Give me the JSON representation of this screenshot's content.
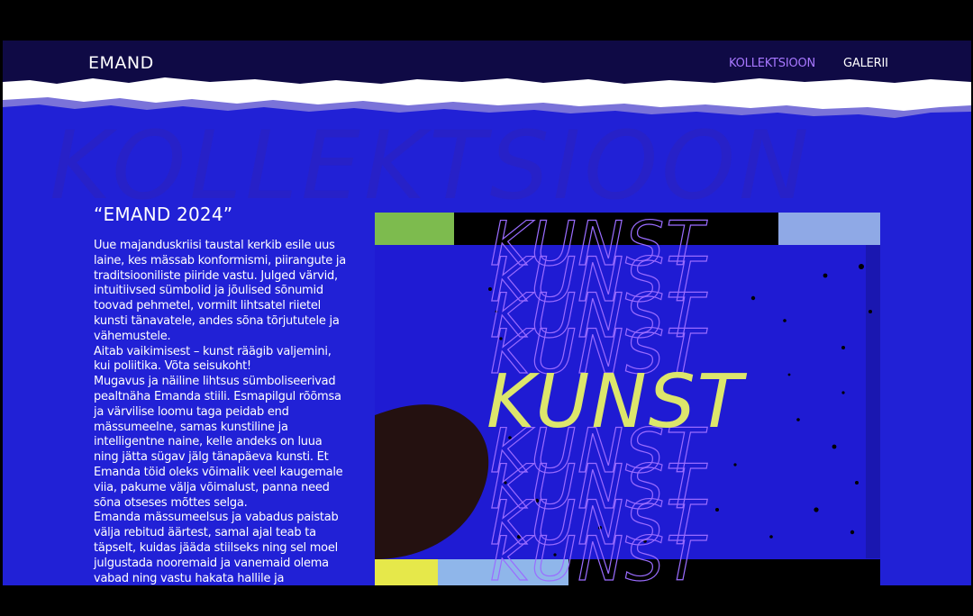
{
  "header": {
    "logo": "EMAND",
    "nav": [
      {
        "label": "KOLLEKTSIOON",
        "active": true
      },
      {
        "label": "GALERII",
        "active": false
      }
    ]
  },
  "section": {
    "background_word": "KOLLEKTSIOON",
    "title": "“EMAND 2024”",
    "paragraphs": [
      "Uue majanduskriisi taustal kerkib esile uus laine, kes mässab konformismi, piirangute ja traditsiooniliste piiride vastu. Julged värvid, intuitiivsed sümbolid ja jõulised sõnumid toovad pehmetel, vormilt lihtsatel riietel kunsti tänavatele, andes sõna tõrjututele ja vähemustele.",
      "Aitab vaikimisest – kunst räägib valjemini, kui poliitika. Võta seisukoht!",
      "Mugavus ja näiline lihtsus sümboliseerivad pealtnäha Emanda stiili. Esmapilgul rõõmsa ja värvilise loomu taga peidab end mässumeelne, samas kunstiline ja intelligentne naine, kelle andeks on luua ning jätta sügav jälg tänapäeva kunsti. Et Emanda töid oleks võimalik veel kaugemale viia, pakume välja võimalust, panna need sõna otseses mõttes selga.",
      "Emanda mässumeelsus ja vabadus paistab välja rebitud äärtest, samal ajal teab ta täpselt, kuidas jääda stiilseks ning sel moel julgustada nooremaid ja vanemaid olema vabad ning vastu hakata hallile ja"
    ]
  },
  "artwork": {
    "word": "KUNST"
  },
  "colors": {
    "background": "#2121d6",
    "header": "#0f0a45",
    "accent": "#a777ff",
    "kunst": "#dde66b"
  }
}
